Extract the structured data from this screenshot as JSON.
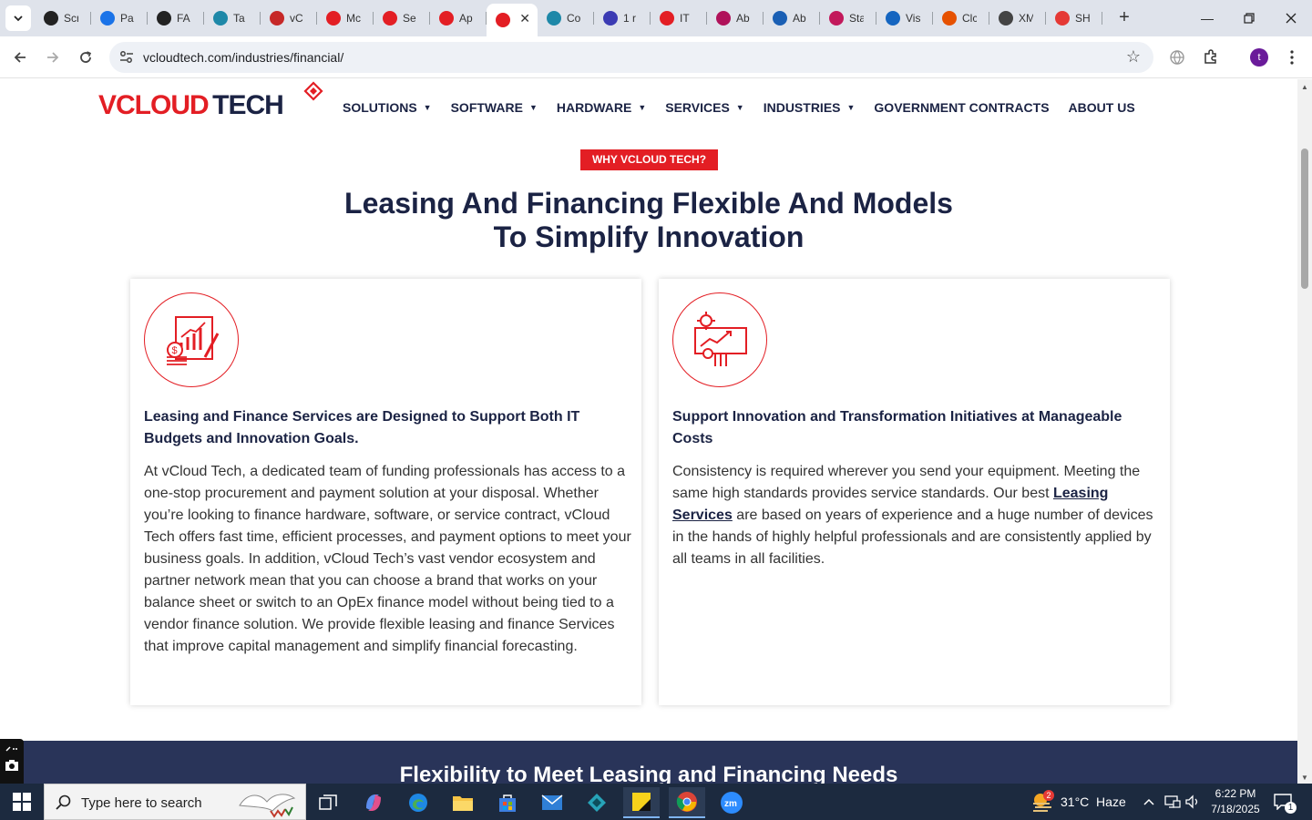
{
  "browser": {
    "tabs": [
      {
        "title": "Scr",
        "icon": "screen-record-icon",
        "color": "#222222"
      },
      {
        "title": "Pa",
        "icon": "page-speed-icon",
        "color": "#1a73e8"
      },
      {
        "title": "FA",
        "icon": "openai-icon",
        "color": "#222222"
      },
      {
        "title": "Ta",
        "icon": "task-icon",
        "color": "#1e88a8"
      },
      {
        "title": "vC",
        "icon": "vcloud-v-icon",
        "color": "#c62828"
      },
      {
        "title": "Mc",
        "icon": "vcloud-diamond-icon",
        "color": "#e31e24"
      },
      {
        "title": "Se",
        "icon": "vcloud-diamond-icon",
        "color": "#e31e24"
      },
      {
        "title": "Ap",
        "icon": "vcloud-diamond-icon",
        "color": "#e31e24"
      },
      {
        "title": "",
        "icon": "vcloud-diamond-icon",
        "color": "#e31e24",
        "active": true
      },
      {
        "title": "Co",
        "icon": "copilot-icon",
        "color": "#1e88a8"
      },
      {
        "title": "1 r",
        "icon": "x-icon",
        "color": "#3b3bb3"
      },
      {
        "title": "IT",
        "icon": "vcloud-diamond-icon",
        "color": "#e31e24"
      },
      {
        "title": "Ab",
        "icon": "vcloud-diamond-icon",
        "color": "#b0125a"
      },
      {
        "title": "Ab",
        "icon": "scales-icon",
        "color": "#1a5fb4"
      },
      {
        "title": "Sta",
        "icon": "pen-icon",
        "color": "#c2185b"
      },
      {
        "title": "Vis",
        "icon": "pulse-icon",
        "color": "#1565c0"
      },
      {
        "title": "Clc",
        "icon": "scribble-icon",
        "color": "#e65100"
      },
      {
        "title": "XM",
        "icon": "globe-icon",
        "color": "#444444"
      },
      {
        "title": "SH",
        "icon": "ring-icon",
        "color": "#e53935"
      }
    ],
    "url": "vcloudtech.com/industries/financial/",
    "avatar_letter": "t"
  },
  "site": {
    "logo_left": "VCLOUD",
    "logo_right": "TECH",
    "nav": [
      {
        "label": "SOLUTIONS",
        "dropdown": true
      },
      {
        "label": "SOFTWARE",
        "dropdown": true
      },
      {
        "label": "HARDWARE",
        "dropdown": true
      },
      {
        "label": "SERVICES",
        "dropdown": true
      },
      {
        "label": "INDUSTRIES",
        "dropdown": true
      },
      {
        "label": "GOVERNMENT CONTRACTS",
        "dropdown": false
      },
      {
        "label": "ABOUT US",
        "dropdown": false
      }
    ],
    "badge": "WHY VCLOUD TECH?",
    "headline_line1": "Leasing And Financing Flexible And Models",
    "headline_line2": "To Simplify Innovation",
    "card1": {
      "title": "Leasing and Finance Services are Designed to Support Both IT Budgets and Innovation Goals.",
      "body": "At vCloud Tech, a dedicated team of funding professionals has access to a one-stop procurement and payment solution at your disposal. Whether you’re looking to finance hardware, software, or service contract, vCloud Tech offers fast time, efficient processes, and payment options to meet your business goals. In addition, vCloud Tech’s vast vendor ecosystem and partner network mean that you can choose a brand that works on your balance sheet or switch to an OpEx finance model without being tied to a vendor finance solution. We provide flexible leasing and finance Services that improve capital management and simplify financial forecasting."
    },
    "card2": {
      "title": "Support Innovation and Transformation Initiatives at Manageable Costs",
      "body_before": "Consistency is required wherever you send your equipment. Meeting the same high standards provides service standards. Our best ",
      "link": "Leasing Services",
      "body_after": " are based on years of experience and a huge number of devices in the hands of highly helpful professionals and are consistently applied by all teams in all facilities."
    },
    "section2_title": "Flexibility to Meet Leasing and Financing Needs",
    "colors": {
      "accent": "#e31e24",
      "navy": "#1b2344",
      "band": "#293459"
    }
  },
  "taskbar": {
    "search_placeholder": "Type here to search",
    "weather": "31°C  Haze",
    "weather_badge": "2",
    "time": "6:22 PM",
    "date": "7/18/2025",
    "notification_count": "1"
  }
}
